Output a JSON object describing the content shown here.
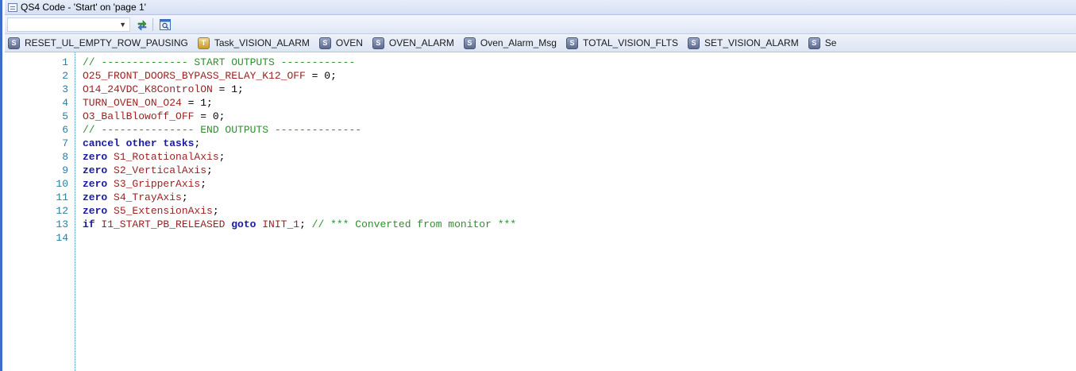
{
  "window": {
    "title": "QS4 Code - 'Start' on 'page 1'"
  },
  "toolbar": {
    "combo_value": ""
  },
  "tabs": [
    {
      "label": "RESET_UL_EMPTY_ROW_PAUSING",
      "icon": "variable-icon"
    },
    {
      "label": "Task_VISION_ALARM",
      "icon": "task-icon"
    },
    {
      "label": "OVEN",
      "icon": "variable-icon"
    },
    {
      "label": "OVEN_ALARM",
      "icon": "variable-icon"
    },
    {
      "label": "Oven_Alarm_Msg",
      "icon": "variable-icon"
    },
    {
      "label": "TOTAL_VISION_FLTS",
      "icon": "variable-icon"
    },
    {
      "label": "SET_VISION_ALARM",
      "icon": "variable-icon"
    },
    {
      "label": "Se",
      "icon": "variable-icon"
    }
  ],
  "code": [
    {
      "n": "1",
      "tokens": [
        {
          "t": "cm",
          "v": "// -------------- START OUTPUTS ------------"
        }
      ]
    },
    {
      "n": "2",
      "tokens": [
        {
          "t": "id",
          "v": "O25_FRONT_DOORS_BYPASS_RELAY_K12_OFF"
        },
        {
          "t": "op",
          "v": " = 0;"
        }
      ]
    },
    {
      "n": "3",
      "tokens": [
        {
          "t": "id",
          "v": "O14_24VDC_K8ControlON"
        },
        {
          "t": "op",
          "v": " = 1;"
        }
      ]
    },
    {
      "n": "4",
      "tokens": [
        {
          "t": "id",
          "v": "TURN_OVEN_ON_O24"
        },
        {
          "t": "op",
          "v": " = 1;"
        }
      ]
    },
    {
      "n": "5",
      "tokens": [
        {
          "t": "id",
          "v": "O3_BallBlowoff_OFF"
        },
        {
          "t": "op",
          "v": " = 0;"
        }
      ]
    },
    {
      "n": "6",
      "tokens": [
        {
          "t": "cm",
          "v": "// --------------- END OUTPUTS --------------"
        }
      ]
    },
    {
      "n": "7",
      "tokens": [
        {
          "t": "kw",
          "v": "cancel other tasks"
        },
        {
          "t": "op",
          "v": ";"
        }
      ]
    },
    {
      "n": "8",
      "tokens": [
        {
          "t": "kw",
          "v": "zero "
        },
        {
          "t": "id",
          "v": "S1_RotationalAxis"
        },
        {
          "t": "op",
          "v": ";"
        }
      ]
    },
    {
      "n": "9",
      "tokens": [
        {
          "t": "kw",
          "v": "zero "
        },
        {
          "t": "id",
          "v": "S2_VerticalAxis"
        },
        {
          "t": "op",
          "v": ";"
        }
      ]
    },
    {
      "n": "10",
      "tokens": [
        {
          "t": "kw",
          "v": "zero "
        },
        {
          "t": "id",
          "v": "S3_GripperAxis"
        },
        {
          "t": "op",
          "v": ";"
        }
      ]
    },
    {
      "n": "11",
      "tokens": [
        {
          "t": "kw",
          "v": "zero "
        },
        {
          "t": "id",
          "v": "S4_TrayAxis"
        },
        {
          "t": "op",
          "v": ";"
        }
      ]
    },
    {
      "n": "12",
      "tokens": [
        {
          "t": "kw",
          "v": "zero "
        },
        {
          "t": "id",
          "v": "S5_ExtensionAxis"
        },
        {
          "t": "op",
          "v": ";"
        }
      ]
    },
    {
      "n": "13",
      "tokens": [
        {
          "t": "kw",
          "v": "if "
        },
        {
          "t": "id",
          "v": "I1_START_PB_RELEASED"
        },
        {
          "t": "kw",
          "v": " goto "
        },
        {
          "t": "id",
          "v": "INIT_1"
        },
        {
          "t": "op",
          "v": "; "
        },
        {
          "t": "cm",
          "v": "// *** Converted from monitor ***"
        }
      ]
    },
    {
      "n": "14",
      "tokens": []
    }
  ]
}
